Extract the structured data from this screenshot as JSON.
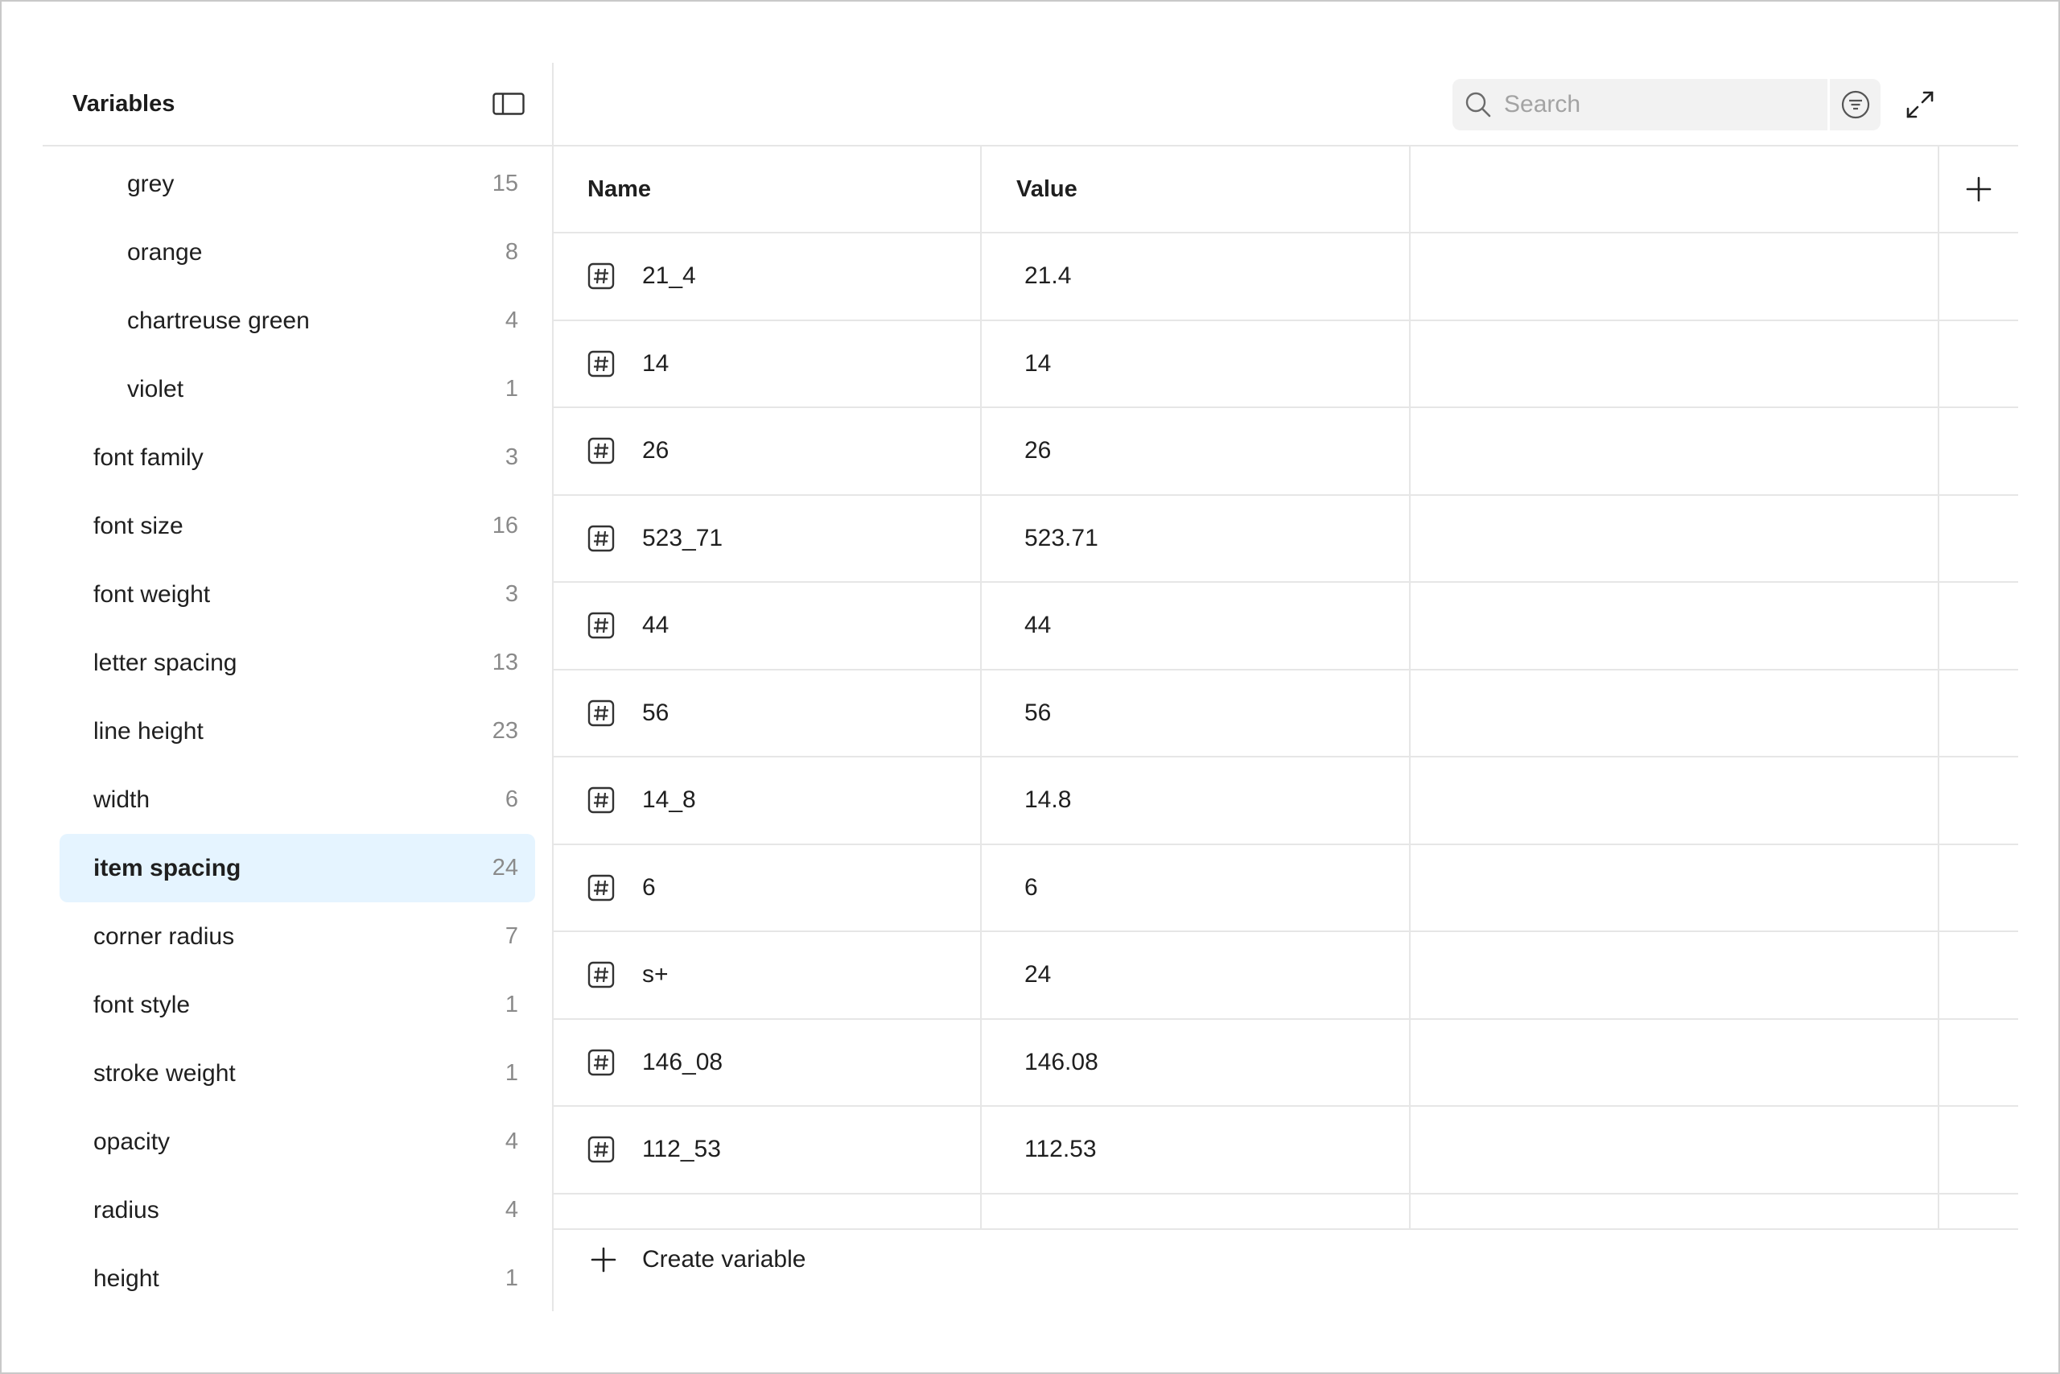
{
  "sidebar": {
    "title": "Variables",
    "groups": [
      {
        "label": "grey",
        "count": "15",
        "child": true
      },
      {
        "label": "orange",
        "count": "8",
        "child": true
      },
      {
        "label": "chartreuse green",
        "count": "4",
        "child": true
      },
      {
        "label": "violet",
        "count": "1",
        "child": true
      },
      {
        "label": "font family",
        "count": "3"
      },
      {
        "label": "font size",
        "count": "16"
      },
      {
        "label": "font weight",
        "count": "3"
      },
      {
        "label": "letter spacing",
        "count": "13"
      },
      {
        "label": "line height",
        "count": "23"
      },
      {
        "label": "width",
        "count": "6"
      },
      {
        "label": "item spacing",
        "count": "24",
        "selected": true
      },
      {
        "label": "corner radius",
        "count": "7"
      },
      {
        "label": "font style",
        "count": "1"
      },
      {
        "label": "stroke weight",
        "count": "1"
      },
      {
        "label": "opacity",
        "count": "4"
      },
      {
        "label": "radius",
        "count": "4"
      },
      {
        "label": "height",
        "count": "1"
      }
    ]
  },
  "search": {
    "placeholder": "Search",
    "value": ""
  },
  "table": {
    "headers": {
      "name": "Name",
      "value": "Value"
    },
    "rows": [
      {
        "name": "21_4",
        "value": "21.4"
      },
      {
        "name": "14",
        "value": "14"
      },
      {
        "name": "26",
        "value": "26"
      },
      {
        "name": "523_71",
        "value": "523.71"
      },
      {
        "name": "44",
        "value": "44"
      },
      {
        "name": "56",
        "value": "56"
      },
      {
        "name": "14_8",
        "value": "14.8"
      },
      {
        "name": "6",
        "value": "6"
      },
      {
        "name": "s+",
        "value": "24"
      },
      {
        "name": "146_08",
        "value": "146.08"
      },
      {
        "name": "112_53",
        "value": "112.53"
      }
    ]
  },
  "footer": {
    "create_label": "Create variable"
  },
  "icons": {
    "panel_toggle": "sidebar-panel-icon",
    "search": "search-icon",
    "filter": "filter-icon",
    "expand": "expand-icon",
    "close": "close-icon",
    "add_column": "plus-icon",
    "variable_type": "number-variable-icon"
  },
  "colors": {
    "selected_bg": "#e5f4ff",
    "border": "#e6e6e6",
    "search_bg": "#f2f2f2",
    "muted_text": "#8a8a8a"
  }
}
